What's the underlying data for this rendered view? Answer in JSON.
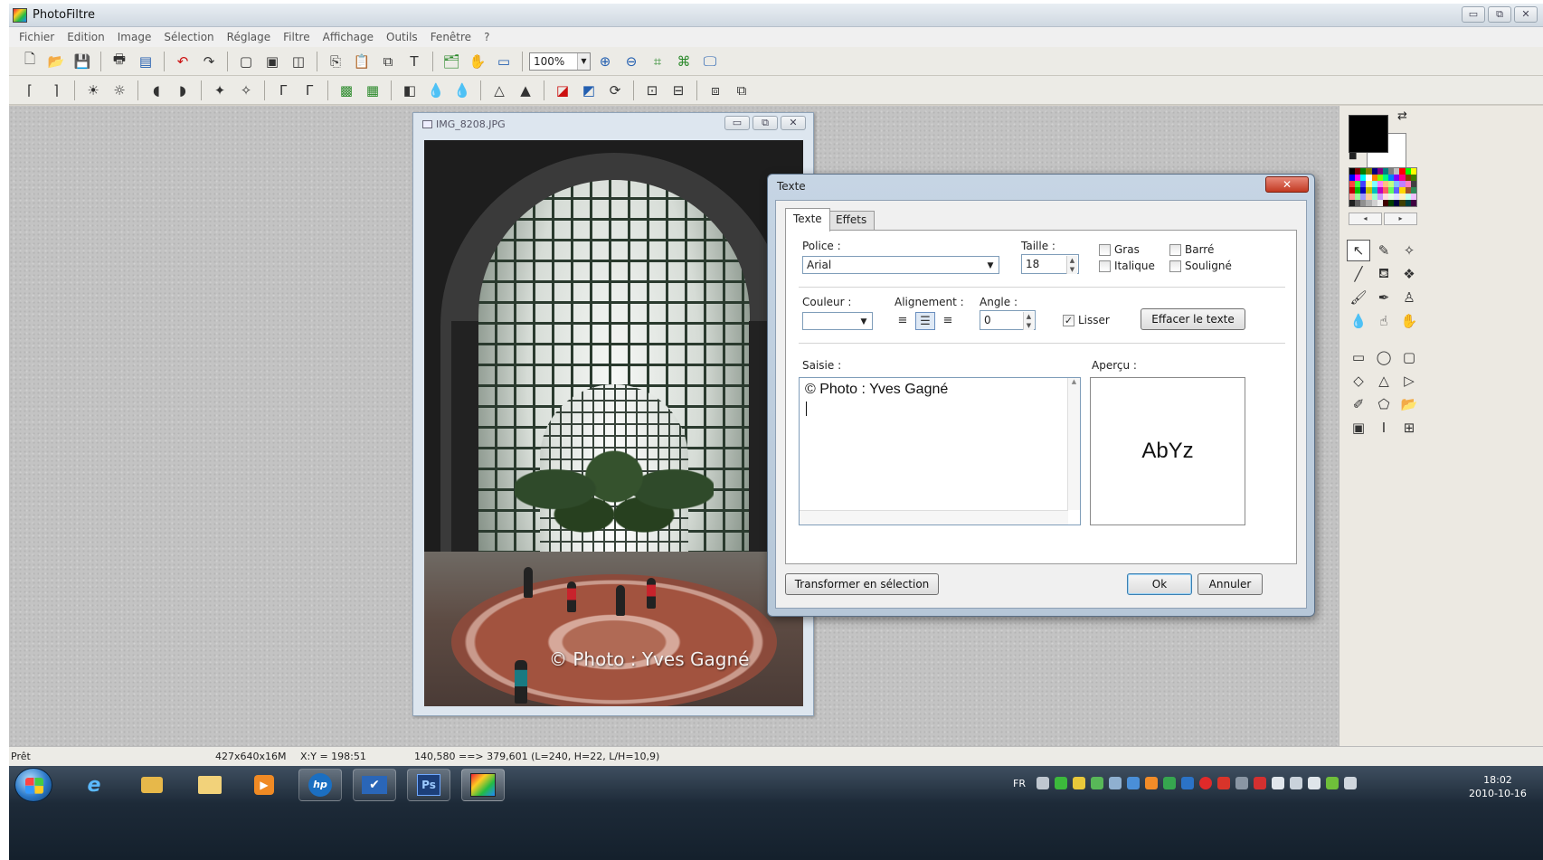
{
  "app": {
    "title": "PhotoFiltre",
    "window_controls": [
      "▭",
      "⧉",
      "✕"
    ]
  },
  "menu": [
    "Fichier",
    "Edition",
    "Image",
    "Sélection",
    "Réglage",
    "Filtre",
    "Affichage",
    "Outils",
    "Fenêtre",
    "?"
  ],
  "toolbar": {
    "zoom_value": "100%"
  },
  "document": {
    "title": "IMG_8208.JPG",
    "watermark": "© Photo : Yves Gagné"
  },
  "dialog": {
    "title": "Texte",
    "close_label": "✕",
    "tabs": [
      "Texte",
      "Effets"
    ],
    "police_label": "Police :",
    "police_value": "Arial",
    "taille_label": "Taille :",
    "taille_value": "18",
    "gras_label": "Gras",
    "italique_label": "Italique",
    "barre_label": "Barré",
    "souligne_label": "Souligné",
    "couleur_label": "Couleur :",
    "alignement_label": "Alignement :",
    "angle_label": "Angle :",
    "angle_value": "0",
    "lisser_label": "Lisser",
    "lisser_checked": true,
    "effacer_label": "Effacer le texte",
    "saisie_label": "Saisie :",
    "saisie_text": "© Photo : Yves Gagné",
    "apercu_label": "Aperçu :",
    "apercu_text": "AbYz",
    "transformer_label": "Transformer en sélection",
    "ok_label": "Ok",
    "annuler_label": "Annuler",
    "colors": {
      "title_bar": "#c6d5e4",
      "close_button": "#c23a22"
    }
  },
  "palette": {
    "foreground_color": "#000000",
    "background_color": "#ffffff",
    "swatches": [
      "#000000",
      "#800000",
      "#008000",
      "#808000",
      "#000080",
      "#800080",
      "#008080",
      "#808080",
      "#c0c0c0",
      "#ff0000",
      "#00ff00",
      "#ffff00",
      "#0000ff",
      "#ff00ff",
      "#00ffff",
      "#ffffff",
      "#ff8000",
      "#80ff00",
      "#00ff80",
      "#0080ff",
      "#8000ff",
      "#ff0080",
      "#804000",
      "#408000",
      "#ff4040",
      "#40ff40",
      "#4040ff",
      "#ffff80",
      "#80ffff",
      "#ff80ff",
      "#ffc080",
      "#c0ff80",
      "#80c0ff",
      "#c080ff",
      "#ff80c0",
      "#404040",
      "#c00000",
      "#00c000",
      "#0000c0",
      "#c0c000",
      "#00c0c0",
      "#c000c0",
      "#ff6060",
      "#60ff60",
      "#6060ff",
      "#ffd700",
      "#a0522d",
      "#2e8b57",
      "#ff9999",
      "#99ff99",
      "#9999ff",
      "#ffcc99",
      "#99ffcc",
      "#cc99ff",
      "#ffe0e0",
      "#e0ffe0",
      "#e0e0ff",
      "#fff0c0",
      "#c0fff0",
      "#f0c0ff",
      "#202020",
      "#606060",
      "#909090",
      "#b0b0b0",
      "#d0d0d0",
      "#f0f0f0",
      "#400000",
      "#004000",
      "#000040",
      "#404000",
      "#004040",
      "#400040"
    ]
  },
  "statusbar": {
    "state": "Prêt",
    "size": "427x640x16M",
    "coords": "X:Y = 198:51",
    "selection": "140,580 ==> 379,601 (L=240, H=22, L/H=10,9)"
  },
  "taskbar": {
    "apps": [
      "e",
      "hp",
      "Ps"
    ],
    "language": "FR",
    "clock_time": "18:02",
    "clock_date": "2010-10-16"
  }
}
